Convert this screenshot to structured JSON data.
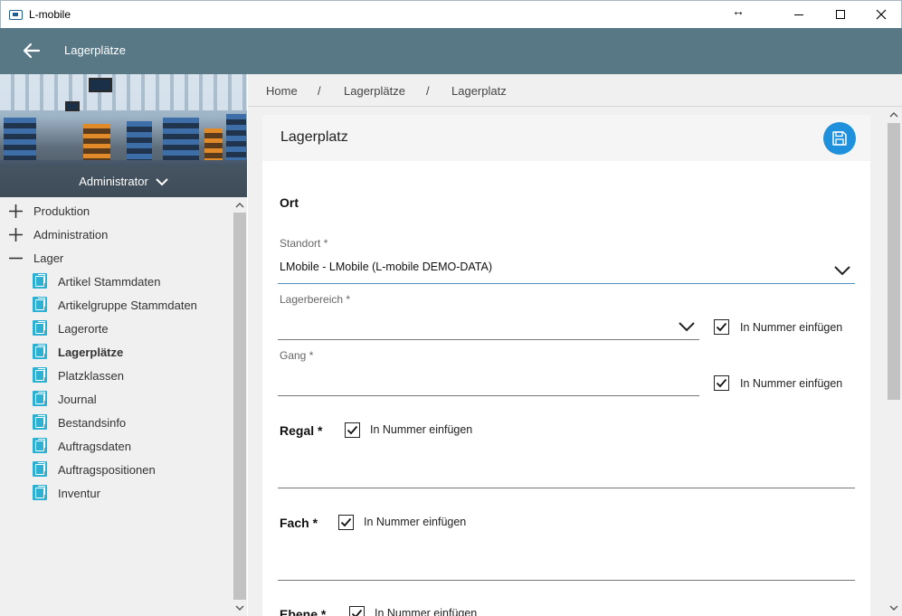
{
  "window": {
    "title": "L-mobile"
  },
  "appbar": {
    "title": "Lagerplätze"
  },
  "sidebar": {
    "user": "Administrator",
    "groups": [
      {
        "label": "Produktion",
        "state": "collapsed"
      },
      {
        "label": "Administration",
        "state": "collapsed"
      },
      {
        "label": "Lager",
        "state": "expanded"
      }
    ],
    "items": [
      {
        "label": "Artikel Stammdaten"
      },
      {
        "label": "Artikelgruppe Stammdaten"
      },
      {
        "label": "Lagerorte"
      },
      {
        "label": "Lagerplätze",
        "active": true
      },
      {
        "label": "Platzklassen"
      },
      {
        "label": "Journal"
      },
      {
        "label": "Bestandsinfo"
      },
      {
        "label": "Auftragsdaten"
      },
      {
        "label": "Auftragspositionen"
      },
      {
        "label": "Inventur"
      }
    ]
  },
  "breadcrumb": {
    "home": "Home",
    "sep": "/",
    "level1": "Lagerplätze",
    "level2": "Lagerplatz"
  },
  "card": {
    "title": "Lagerplatz"
  },
  "form": {
    "section_ort": "Ort",
    "standort_label": "Standort *",
    "standort_value": "LMobile - LMobile (L-mobile DEMO-DATA)",
    "lagerbereich_label": "Lagerbereich *",
    "lagerbereich_value": "",
    "gang_label": "Gang *",
    "gang_value": "",
    "regal_label": "Regal *",
    "regal_value": "",
    "fach_label": "Fach *",
    "fach_value": "",
    "ebene_label": "Ebene *",
    "checkbox_label": "In Nummer einfügen"
  },
  "colors": {
    "header": "#597885",
    "accent": "#1e90dc",
    "doc_icon": "#2eb0d2"
  }
}
